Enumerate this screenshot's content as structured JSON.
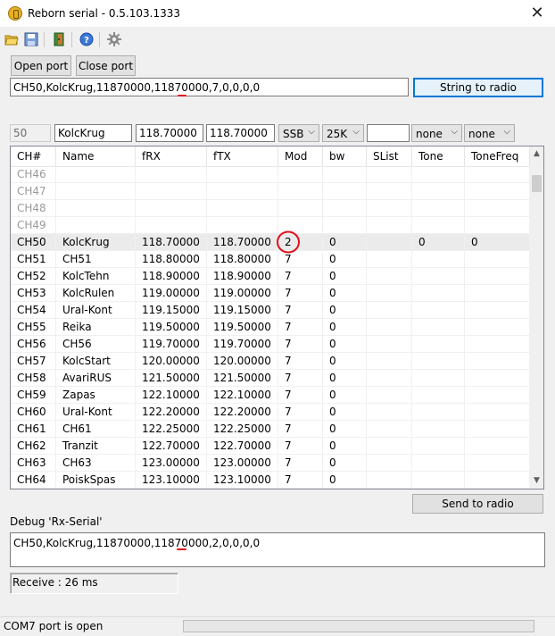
{
  "window": {
    "title": "Reborn serial - 0.5.103.1333",
    "close_glyph": "✕"
  },
  "toolbar": {
    "icons": [
      "open-folder-icon",
      "save-icon",
      "exit-icon",
      "help-icon",
      "gear-icon"
    ]
  },
  "port": {
    "open_label": "Open port",
    "close_label": "Close port"
  },
  "command": {
    "value": "CH50,KolcKrug,11870000,11870000,7,0,0,0,0",
    "send_label": "String to radio"
  },
  "editor": {
    "channel": "50",
    "name": "KolcKrug",
    "frx": "118.70000",
    "ftx": "118.70000",
    "mod": "SSB",
    "bw": "25K",
    "slist": "",
    "tone": "none",
    "tonefreq": "none"
  },
  "table": {
    "columns": [
      "CH#",
      "Name",
      "fRX",
      "fTX",
      "Mod",
      "bw",
      "SList",
      "Tone",
      "ToneFreq"
    ],
    "rows": [
      [
        "CH46",
        "",
        "",
        "",
        "",
        "",
        "",
        "",
        ""
      ],
      [
        "CH47",
        "",
        "",
        "",
        "",
        "",
        "",
        "",
        ""
      ],
      [
        "CH48",
        "",
        "",
        "",
        "",
        "",
        "",
        "",
        ""
      ],
      [
        "CH49",
        "",
        "",
        "",
        "",
        "",
        "",
        "",
        ""
      ],
      [
        "CH50",
        "KolcKrug",
        "118.70000",
        "118.70000",
        "2",
        "0",
        "",
        "0",
        "0"
      ],
      [
        "CH51",
        "CH51",
        "118.80000",
        "118.80000",
        "7",
        "0",
        "",
        "",
        ""
      ],
      [
        "CH52",
        "KolcTehn",
        "118.90000",
        "118.90000",
        "7",
        "0",
        "",
        "",
        ""
      ],
      [
        "CH53",
        "KolcRulen",
        "119.00000",
        "119.00000",
        "7",
        "0",
        "",
        "",
        ""
      ],
      [
        "CH54",
        "Ural-Kont",
        "119.15000",
        "119.15000",
        "7",
        "0",
        "",
        "",
        ""
      ],
      [
        "CH55",
        "Reika",
        "119.50000",
        "119.50000",
        "7",
        "0",
        "",
        "",
        ""
      ],
      [
        "CH56",
        "CH56",
        "119.70000",
        "119.70000",
        "7",
        "0",
        "",
        "",
        ""
      ],
      [
        "CH57",
        "KolcStart",
        "120.00000",
        "120.00000",
        "7",
        "0",
        "",
        "",
        ""
      ],
      [
        "CH58",
        "AvariRUS",
        "121.50000",
        "121.50000",
        "7",
        "0",
        "",
        "",
        ""
      ],
      [
        "CH59",
        "Zapas",
        "122.10000",
        "122.10000",
        "7",
        "0",
        "",
        "",
        ""
      ],
      [
        "CH60",
        "Ural-Kont",
        "122.20000",
        "122.20000",
        "7",
        "0",
        "",
        "",
        ""
      ],
      [
        "CH61",
        "CH61",
        "122.25000",
        "122.25000",
        "7",
        "0",
        "",
        "",
        ""
      ],
      [
        "CH62",
        "Tranzit",
        "122.70000",
        "122.70000",
        "7",
        "0",
        "",
        "",
        ""
      ],
      [
        "CH63",
        "CH63",
        "123.00000",
        "123.00000",
        "7",
        "0",
        "",
        "",
        ""
      ],
      [
        "CH64",
        "PoiskSpas",
        "123.10000",
        "123.10000",
        "7",
        "0",
        "",
        "",
        ""
      ]
    ],
    "dim_rows": 4,
    "selected_row": 4
  },
  "send_to_radio_label": "Send to radio",
  "debug": {
    "label": "Debug 'Rx-Serial'",
    "value": "CH50,KolcKrug,11870000,11870000,2,0,0,0,0"
  },
  "receive": "Receive : 26 ms",
  "status": "COM7 port is open",
  "colors": {
    "accent": "#0078d7",
    "annotation": "#e0101a"
  }
}
